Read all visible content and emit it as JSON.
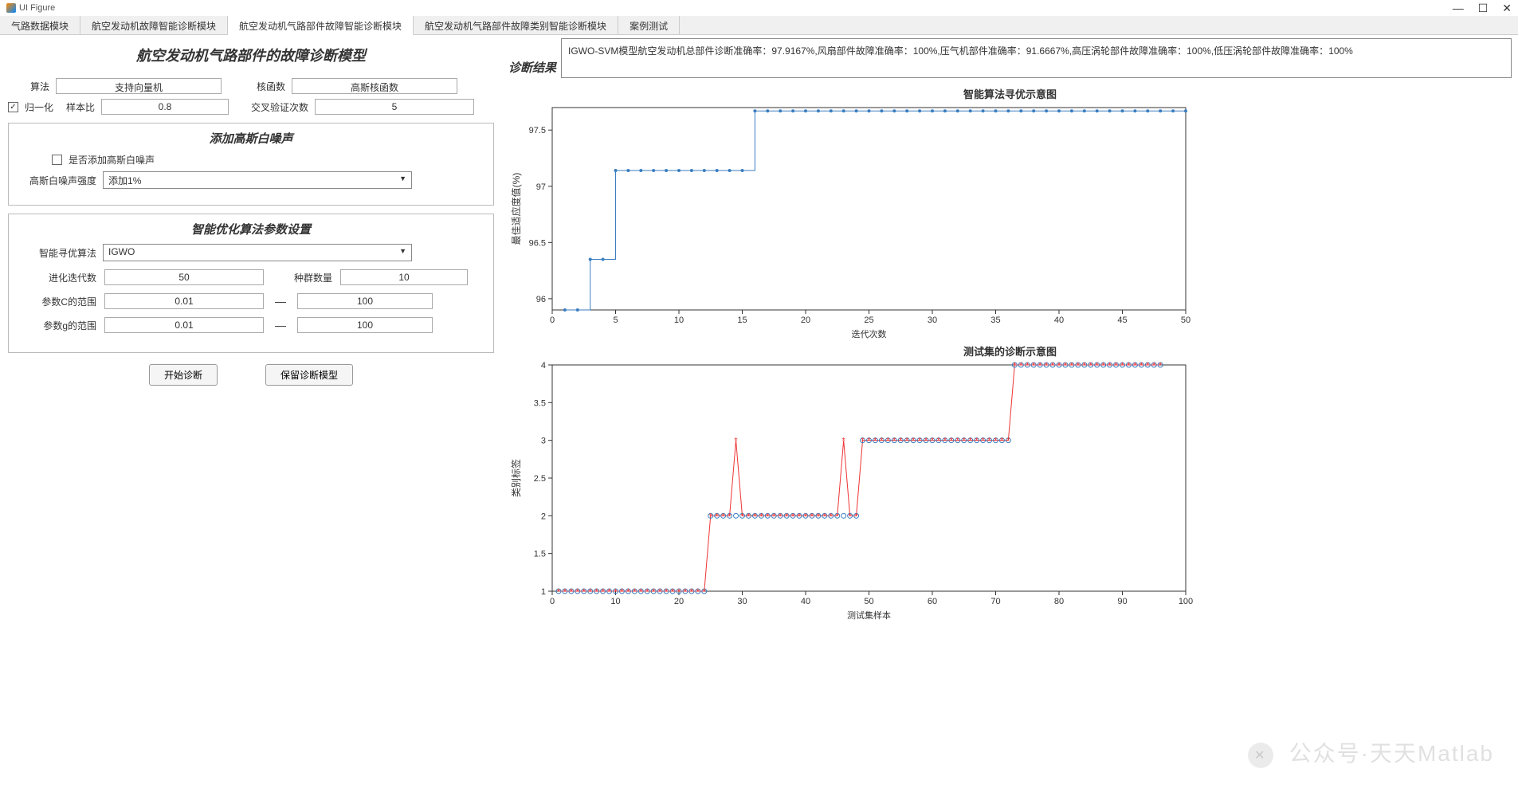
{
  "window": {
    "title": "UI Figure"
  },
  "tabs": [
    {
      "label": "气路数据模块"
    },
    {
      "label": "航空发动机故障智能诊断模块"
    },
    {
      "label": "航空发动机气路部件故障智能诊断模块"
    },
    {
      "label": "航空发动机气路部件故障类别智能诊断模块"
    },
    {
      "label": "案例测试"
    }
  ],
  "active_tab": 2,
  "heading": "航空发动机气路部件的故障诊断模型",
  "params": {
    "algorithm_label": "算法",
    "algorithm_value": "支持向量机",
    "kernel_label": "核函数",
    "kernel_value": "高斯核函数",
    "normalize_label": "归一化",
    "normalize_checked": true,
    "sample_ratio_label": "样本比",
    "sample_ratio_value": "0.8",
    "cv_label": "交叉验证次数",
    "cv_value": "5"
  },
  "noise_group": {
    "title": "添加高斯白噪声",
    "add_label": "是否添加高斯白噪声",
    "add_checked": false,
    "intensity_label": "高斯白噪声强度",
    "intensity_value": "添加1%"
  },
  "opt_group": {
    "title": "智能优化算法参数设置",
    "algo_label": "智能寻优算法",
    "algo_value": "IGWO",
    "iter_label": "进化迭代数",
    "iter_value": "50",
    "pop_label": "种群数量",
    "pop_value": "10",
    "c_label": "参数C的范围",
    "c_min": "0.01",
    "c_max": "100",
    "g_label": "参数g的范围",
    "g_min": "0.01",
    "g_max": "100",
    "sep": "—"
  },
  "buttons": {
    "start": "开始诊断",
    "save": "保留诊断模型"
  },
  "result": {
    "label": "诊断结果",
    "text": "IGWO-SVM模型航空发动机总部件诊断准确率：97.9167%,风扇部件故障准确率：100%,压气机部件准确率：91.6667%,高压涡轮部件故障准确率：100%,低压涡轮部件故障准确率：100%"
  },
  "chart_data": [
    {
      "type": "line",
      "title": "智能算法寻优示意图",
      "xlabel": "迭代次数",
      "ylabel": "最佳适应度值(%)",
      "xlim": [
        0,
        50
      ],
      "ylim": [
        95.9,
        97.7
      ],
      "xticks": [
        0,
        5,
        10,
        15,
        20,
        25,
        30,
        35,
        40,
        45,
        50
      ],
      "yticks": [
        96,
        96.5,
        97,
        97.5
      ],
      "x": [
        1,
        2,
        3,
        4,
        5,
        6,
        7,
        8,
        9,
        10,
        11,
        12,
        13,
        14,
        15,
        16,
        17,
        18,
        19,
        20,
        21,
        22,
        23,
        24,
        25,
        26,
        27,
        28,
        29,
        30,
        31,
        32,
        33,
        34,
        35,
        36,
        37,
        38,
        39,
        40,
        41,
        42,
        43,
        44,
        45,
        46,
        47,
        48,
        49,
        50
      ],
      "y": [
        95.9,
        95.9,
        96.35,
        96.35,
        97.14,
        97.14,
        97.14,
        97.14,
        97.14,
        97.14,
        97.14,
        97.14,
        97.14,
        97.14,
        97.14,
        97.67,
        97.67,
        97.67,
        97.67,
        97.67,
        97.67,
        97.67,
        97.67,
        97.67,
        97.67,
        97.67,
        97.67,
        97.67,
        97.67,
        97.67,
        97.67,
        97.67,
        97.67,
        97.67,
        97.67,
        97.67,
        97.67,
        97.67,
        97.67,
        97.67,
        97.67,
        97.67,
        97.67,
        97.67,
        97.67,
        97.67,
        97.67,
        97.67,
        97.67,
        97.67
      ]
    },
    {
      "type": "line",
      "title": "测试集的诊断示意图",
      "xlabel": "测试集样本",
      "ylabel": "类别标签",
      "xlim": [
        0,
        100
      ],
      "ylim": [
        1,
        4
      ],
      "xticks": [
        0,
        10,
        20,
        30,
        40,
        50,
        60,
        70,
        80,
        90,
        100
      ],
      "yticks": [
        1,
        1.5,
        2,
        2.5,
        3,
        3.5,
        4
      ],
      "series": [
        {
          "name": "true",
          "marker": "o",
          "color": "#3b7ec1",
          "y": [
            1,
            1,
            1,
            1,
            1,
            1,
            1,
            1,
            1,
            1,
            1,
            1,
            1,
            1,
            1,
            1,
            1,
            1,
            1,
            1,
            1,
            1,
            1,
            1,
            2,
            2,
            2,
            2,
            2,
            2,
            2,
            2,
            2,
            2,
            2,
            2,
            2,
            2,
            2,
            2,
            2,
            2,
            2,
            2,
            2,
            2,
            2,
            2,
            3,
            3,
            3,
            3,
            3,
            3,
            3,
            3,
            3,
            3,
            3,
            3,
            3,
            3,
            3,
            3,
            3,
            3,
            3,
            3,
            3,
            3,
            3,
            3,
            4,
            4,
            4,
            4,
            4,
            4,
            4,
            4,
            4,
            4,
            4,
            4,
            4,
            4,
            4,
            4,
            4,
            4,
            4,
            4,
            4,
            4,
            4,
            4
          ]
        },
        {
          "name": "pred",
          "marker": "*",
          "color": "#e33",
          "y": [
            1,
            1,
            1,
            1,
            1,
            1,
            1,
            1,
            1,
            1,
            1,
            1,
            1,
            1,
            1,
            1,
            1,
            1,
            1,
            1,
            1,
            1,
            1,
            1,
            2,
            2,
            2,
            2,
            3,
            2,
            2,
            2,
            2,
            2,
            2,
            2,
            2,
            2,
            2,
            2,
            2,
            2,
            2,
            2,
            2,
            3,
            2,
            2,
            3,
            3,
            3,
            3,
            3,
            3,
            3,
            3,
            3,
            3,
            3,
            3,
            3,
            3,
            3,
            3,
            3,
            3,
            3,
            3,
            3,
            3,
            3,
            3,
            4,
            4,
            4,
            4,
            4,
            4,
            4,
            4,
            4,
            4,
            4,
            4,
            4,
            4,
            4,
            4,
            4,
            4,
            4,
            4,
            4,
            4,
            4,
            4
          ]
        }
      ]
    }
  ],
  "watermark": "公众号·天天Matlab"
}
